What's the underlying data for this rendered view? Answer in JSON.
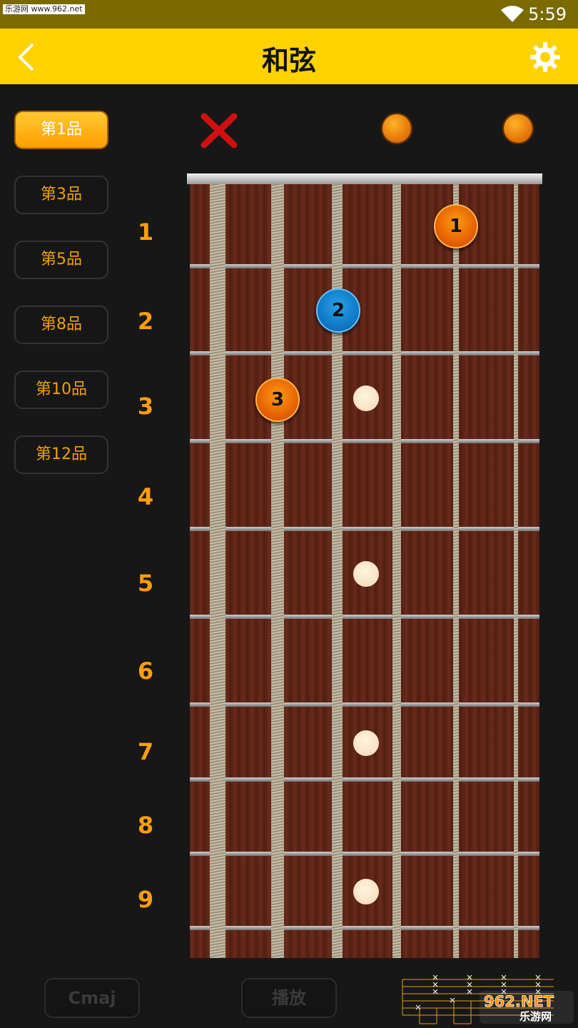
{
  "status_bar": {
    "watermark": "乐游网 www.962.net",
    "time": "5:59"
  },
  "header": {
    "title": "和弦"
  },
  "fret_positions": [
    {
      "label": "第1品",
      "active": true
    },
    {
      "label": "第3品",
      "active": false
    },
    {
      "label": "第5品",
      "active": false
    },
    {
      "label": "第8品",
      "active": false
    },
    {
      "label": "第10品",
      "active": false
    },
    {
      "label": "第12品",
      "active": false
    }
  ],
  "fret_numbers": [
    "1",
    "2",
    "3",
    "4",
    "5",
    "6",
    "7",
    "8",
    "9"
  ],
  "fingers": [
    "1",
    "2",
    "3"
  ],
  "bottom": {
    "chord_label": "Cmaj",
    "play_label": "播放"
  },
  "logo": {
    "text": "962.NET 乐游网"
  },
  "colors": {
    "accent": "#ffd200",
    "orange": "#ff9e0c",
    "blue_finger": "#0c73c0"
  }
}
